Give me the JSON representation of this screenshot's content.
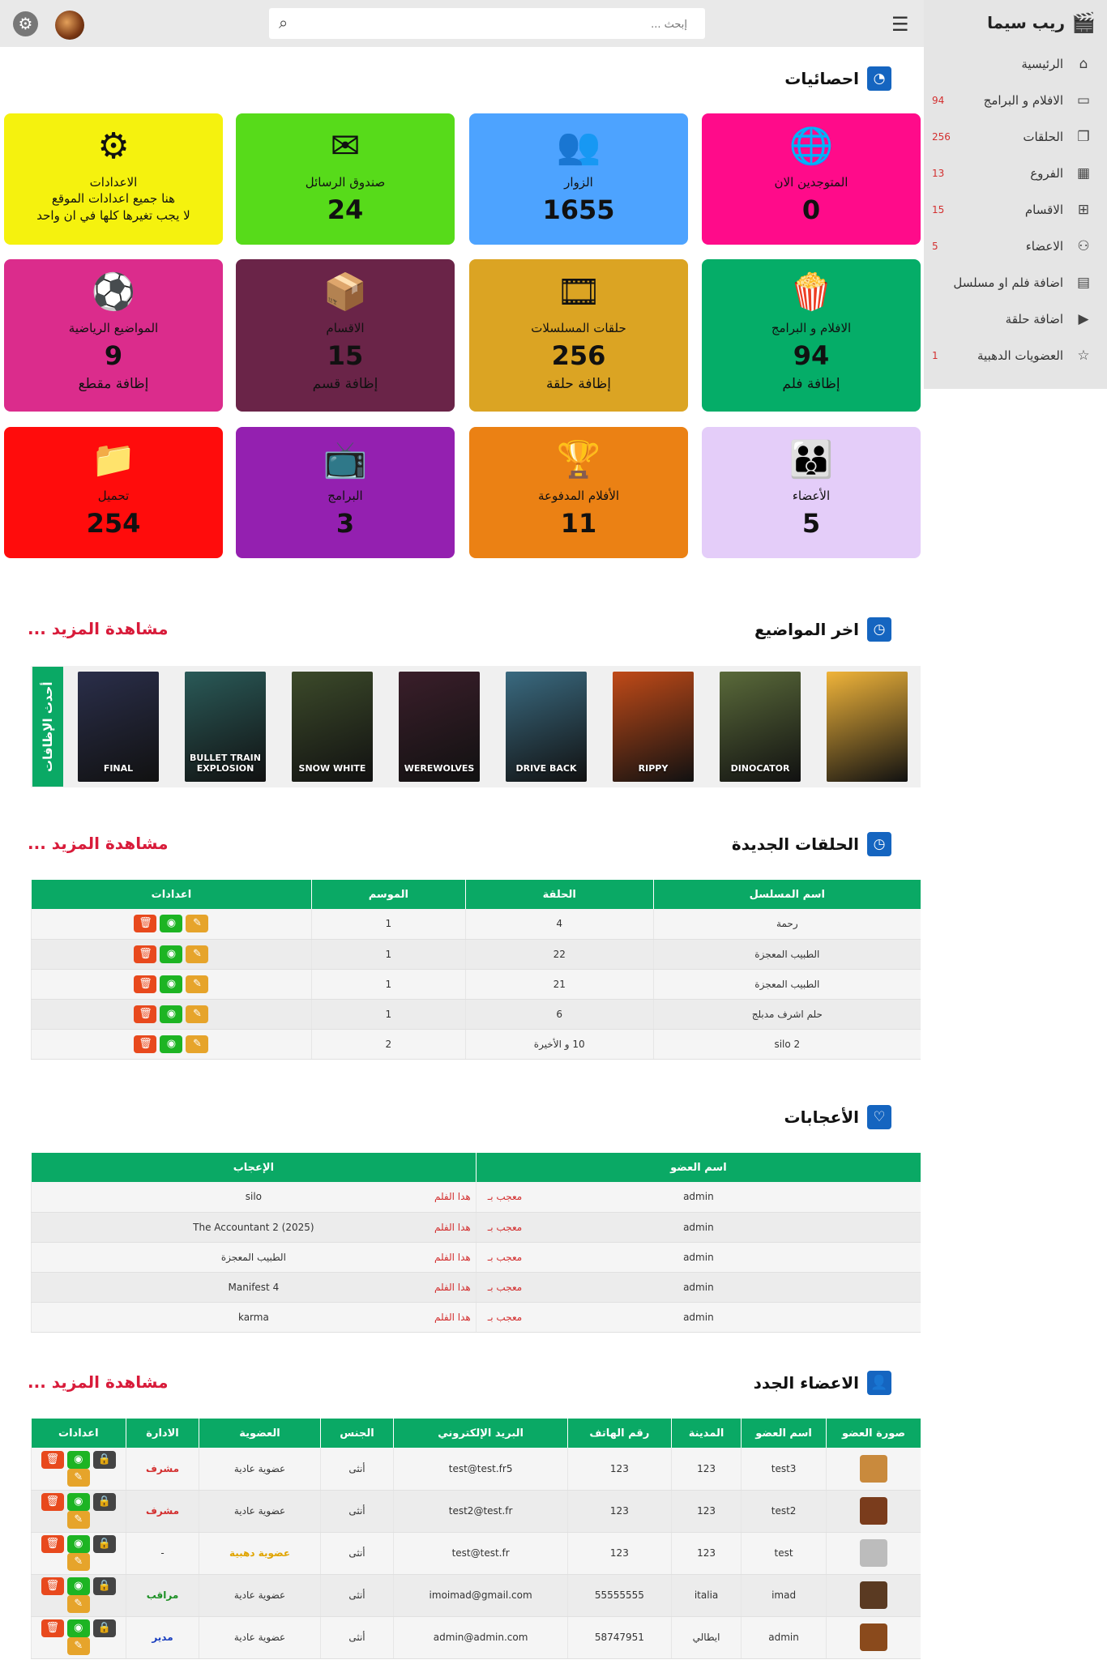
{
  "header": {
    "search_placeholder": "إبحث ..."
  },
  "brand": {
    "title": "ريب سيما"
  },
  "sidebar": {
    "items": [
      {
        "label": "الرئيسية",
        "count": "",
        "icon": "home-icon"
      },
      {
        "label": "الافلام و البرامج",
        "count": "94",
        "icon": "film-icon"
      },
      {
        "label": "الحلقات",
        "count": "256",
        "icon": "episodes-icon"
      },
      {
        "label": "الفروع",
        "count": "13",
        "icon": "grid-icon"
      },
      {
        "label": "الاقسام",
        "count": "15",
        "icon": "sections-icon"
      },
      {
        "label": "الاعضاء",
        "count": "5",
        "icon": "user-icon"
      },
      {
        "label": "اضافة فلم او مسلسل",
        "count": "",
        "icon": "film-strip-icon"
      },
      {
        "label": "اضافة حلقة",
        "count": "",
        "icon": "video-camera-icon"
      },
      {
        "label": "العضويات الدهبية",
        "count": "1",
        "icon": "star-icon"
      }
    ]
  },
  "stats": {
    "title": "احصائيات",
    "cards": [
      {
        "label": "المتوجدين الان",
        "value": "0",
        "add": "",
        "color": "#ff0b8a",
        "icon": "online-globe-icon"
      },
      {
        "label": "الزوار",
        "value": "1655",
        "add": "",
        "color": "#4da3ff",
        "icon": "visitors-icon"
      },
      {
        "label": "صندوق الرسائل",
        "value": "24",
        "add": "",
        "color": "#57db1a",
        "icon": "mail-icon"
      },
      {
        "label": "الاعدادات",
        "sub1": "هنا جميع اعدادات الموقع",
        "sub2": "لا يجب تغيرها كلها في ان واحد",
        "color": "#f5f20e",
        "icon": "settings-tools-icon"
      },
      {
        "label": "الافلام و البرامج",
        "value": "94",
        "add": "إظافة فلم",
        "color": "#05ad68",
        "icon": "popcorn-icon"
      },
      {
        "label": "حلقات المسلسلات",
        "value": "256",
        "add": "إظافة حلقة",
        "color": "#dba423",
        "icon": "film-reel-icon"
      },
      {
        "label": "الاقسام",
        "value": "15",
        "add": "إظافة قسم",
        "color": "#6a2448",
        "icon": "boxes-icon"
      },
      {
        "label": "المواضيع الرياضية",
        "value": "9",
        "add": "إظافة مقطع",
        "color": "#db2c8c",
        "icon": "soccer-icon"
      },
      {
        "label": "الأعضاء",
        "value": "5",
        "add": "",
        "color": "#e4cdf9",
        "icon": "members-icon"
      },
      {
        "label": "الأفلام المدفوعة",
        "value": "11",
        "add": "",
        "color": "#eb8114",
        "icon": "award-icon"
      },
      {
        "label": "البرامج",
        "value": "3",
        "add": "",
        "color": "#9420b0",
        "icon": "tv-icon"
      },
      {
        "label": "تحميل",
        "value": "254",
        "add": "",
        "color": "#ff0c0c",
        "icon": "download-folder-icon"
      }
    ]
  },
  "latest": {
    "title": "اخر المواضيع",
    "more": "مشاهدة المزيد ...",
    "tag": "أحدث الإظافات",
    "posters": [
      {
        "label": "",
        "color": "#f0b43a"
      },
      {
        "label": "DINOCATOR",
        "color": "#5a6a3a"
      },
      {
        "label": "RIPPY",
        "color": "#c04a18"
      },
      {
        "label": "DRIVE BACK",
        "color": "#3a6a80"
      },
      {
        "label": "WEREWOLVES",
        "color": "#3a1e2a"
      },
      {
        "label": "SNOW WHITE",
        "color": "#3c4a2a"
      },
      {
        "label": "BULLET TRAIN EXPLOSION",
        "color": "#2a5a58"
      },
      {
        "label": "FINAL",
        "color": "#2a2e4a"
      }
    ]
  },
  "episodes": {
    "title": "الحلقات الجديدة",
    "more": "مشاهدة المزيد ...",
    "headers": [
      "اسم المسلسل",
      "الحلقة",
      "الموسم",
      "اعدادات"
    ],
    "rows": [
      {
        "series": "رحمة",
        "episode": "4",
        "season": "1"
      },
      {
        "series": "الطبيب المعجزة",
        "episode": "22",
        "season": "1"
      },
      {
        "series": "الطبيب المعجزة",
        "episode": "21",
        "season": "1"
      },
      {
        "series": "حلم اشرف مدبلج",
        "episode": "6",
        "season": "1"
      },
      {
        "series": "silo 2",
        "episode": "10 و الأخيرة",
        "season": "2"
      }
    ]
  },
  "likes": {
    "title": "الأعجابات",
    "headers": [
      "اسم العضو",
      "الإعجاب"
    ],
    "liked_text": "معجب بـ",
    "this_film": "هدا الفلم",
    "rows": [
      {
        "member": "admin",
        "title": "silo"
      },
      {
        "member": "admin",
        "title": "The Accountant 2 (2025)"
      },
      {
        "member": "admin",
        "title": "الطبيب المعجزة"
      },
      {
        "member": "admin",
        "title": "Manifest 4"
      },
      {
        "member": "admin",
        "title": "karma"
      }
    ]
  },
  "members": {
    "title": "الاعضاء الجدد",
    "more": "مشاهدة المزيد ...",
    "headers": [
      "صورة العضو",
      "اسم العضو",
      "المدينة",
      "رقم الهاتف",
      "البريد الإلكتروني",
      "الجنس",
      "العضوية",
      "الادارة",
      "اعدادات"
    ],
    "rows": [
      {
        "name": "test3",
        "city": "123",
        "phone": "123",
        "email": "test@test.fr5",
        "gender": "أنثى",
        "membership": "عضوية عادية",
        "role": "مشرف",
        "role_class": "role-red",
        "member_class": "",
        "thumb": "#c98a3d"
      },
      {
        "name": "test2",
        "city": "123",
        "phone": "123",
        "email": "test2@test.fr",
        "gender": "أنثى",
        "membership": "عضوية عادية",
        "role": "مشرف",
        "role_class": "role-red",
        "member_class": "",
        "thumb": "#7a3c1c"
      },
      {
        "name": "test",
        "city": "123",
        "phone": "123",
        "email": "test@test.fr",
        "gender": "أنثى",
        "membership": "عضوية دهبية",
        "role": "-",
        "role_class": "",
        "member_class": "gold",
        "thumb": "#bcbcbc"
      },
      {
        "name": "imad",
        "city": "italia",
        "phone": "55555555",
        "email": "imoimad@gmail.com",
        "gender": "أنثى",
        "membership": "عضوية عادية",
        "role": "مراقب",
        "role_class": "role-green",
        "member_class": "",
        "thumb": "#5a3a22"
      },
      {
        "name": "admin",
        "city": "ايطالي",
        "phone": "58747951",
        "email": "admin@admin.com",
        "gender": "أنثى",
        "membership": "عضوية عادية",
        "role": "مدير",
        "role_class": "role-blue",
        "member_class": "",
        "thumb": "#8a4a1c"
      }
    ]
  }
}
